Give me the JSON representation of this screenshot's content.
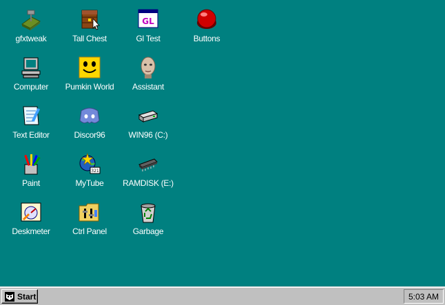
{
  "desktop": {
    "icons": [
      {
        "label": "gfxtweak",
        "icon": "gfxtweak-icon"
      },
      {
        "label": "Tall Chest",
        "icon": "chest-icon"
      },
      {
        "label": "Gl Test",
        "icon": "gl-window-icon"
      },
      {
        "label": "Buttons",
        "icon": "red-button-icon"
      },
      {
        "label": "Computer",
        "icon": "computer-icon"
      },
      {
        "label": "Pumkin World",
        "icon": "pumpkin-face-icon"
      },
      {
        "label": "Assistant",
        "icon": "assistant-face-icon"
      },
      {
        "label": "Text Editor",
        "icon": "notepad-icon"
      },
      {
        "label": "Discor96",
        "icon": "discord-icon"
      },
      {
        "label": "WIN96 (C:)",
        "icon": "hard-drive-icon"
      },
      {
        "label": "Paint",
        "icon": "paint-icon"
      },
      {
        "label": "MyTube",
        "icon": "mytube-icon"
      },
      {
        "label": "RAMDISK (E:)",
        "icon": "ram-chip-icon"
      },
      {
        "label": "Deskmeter",
        "icon": "deskmeter-icon"
      },
      {
        "label": "Ctrl Panel",
        "icon": "control-panel-icon"
      },
      {
        "label": "Garbage",
        "icon": "recycle-bin-icon"
      }
    ]
  },
  "taskbar": {
    "start_label": "Start",
    "clock": "5:03 AM"
  },
  "colors": {
    "desktop": "#008080",
    "taskbar": "#c0c0c0"
  }
}
